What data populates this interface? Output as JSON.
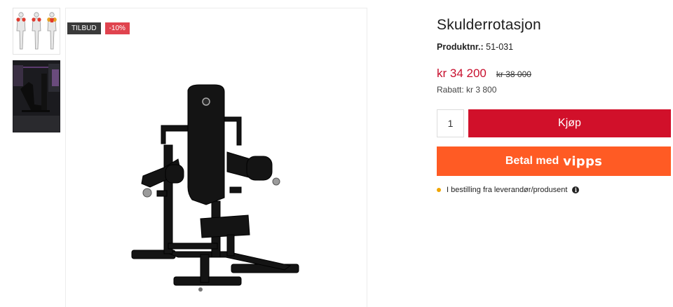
{
  "gallery": {
    "badges": {
      "tilbud": "TILBUD",
      "discount": "-10%"
    }
  },
  "product": {
    "title": "Skulderrotasjon",
    "sku_label": "Produktnr.:",
    "sku_value": "51-031",
    "price": "kr 34 200",
    "old_price": "kr 38 000",
    "rabatt_label": "Rabatt:",
    "rabatt_value": "kr 3 800",
    "quantity": "1",
    "buy_label": "Kjøp",
    "vipps_label": "Betal med",
    "vipps_brand": "vipps",
    "status": "I bestilling fra leverandør/produsent"
  },
  "colors": {
    "price": "#c8102e",
    "buy_button": "#d1102a",
    "vipps_button": "#ff5b24",
    "status_dot": "#f0a500",
    "discount_badge": "#e0434e"
  }
}
